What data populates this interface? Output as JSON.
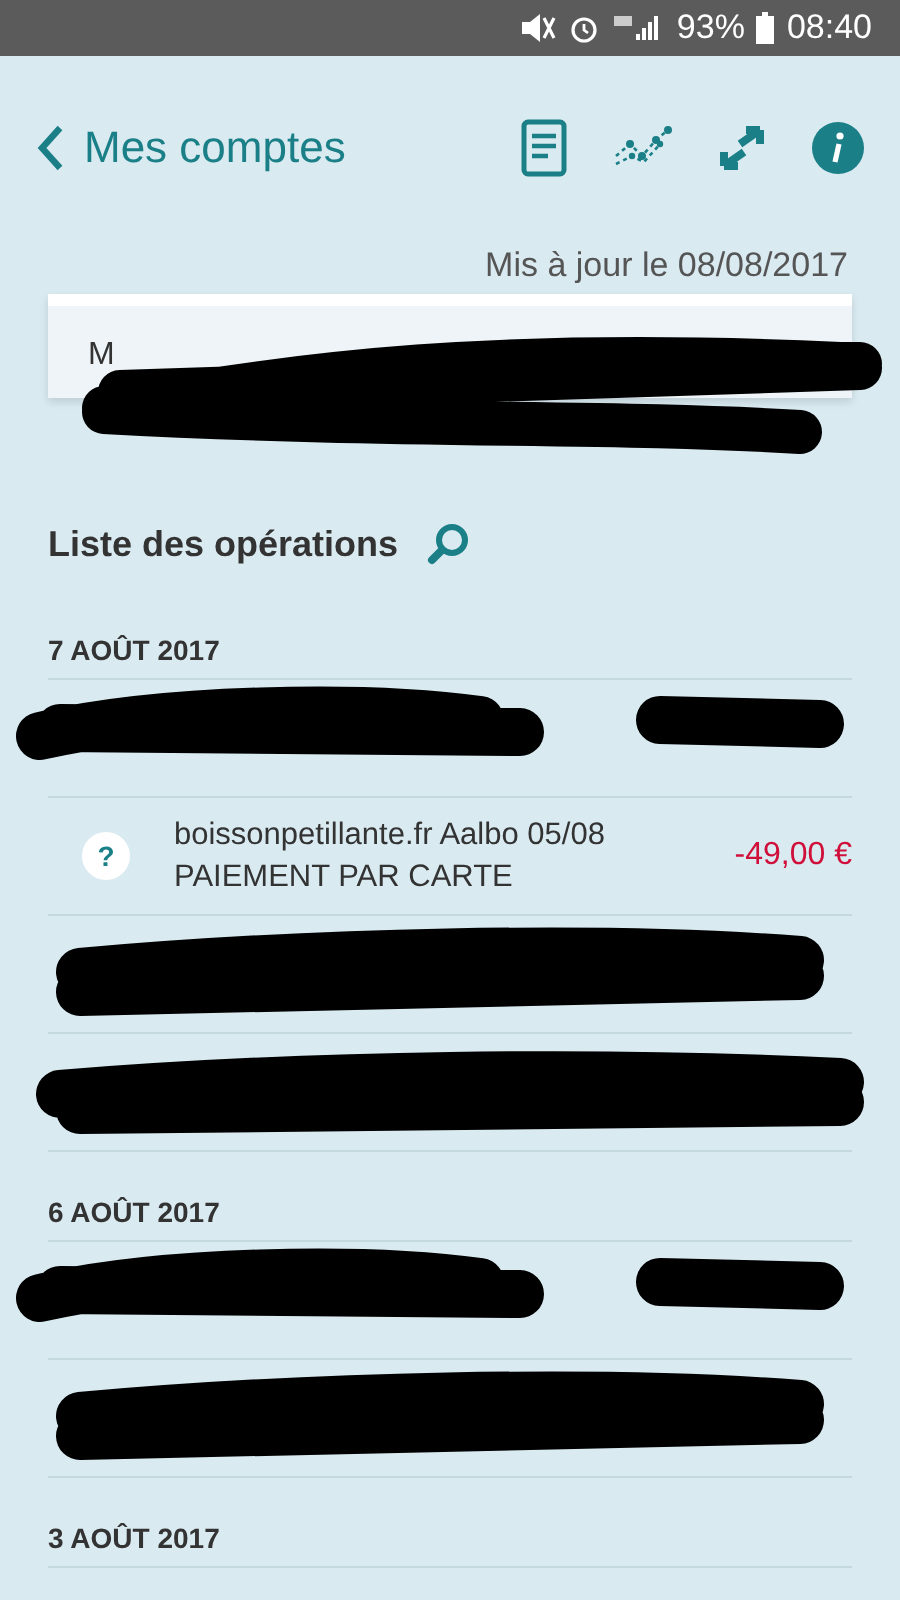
{
  "status_bar": {
    "battery": "93%",
    "time": "08:40"
  },
  "header": {
    "back_label": "Mes comptes"
  },
  "updated": "Mis à jour le 08/08/2017",
  "account_card": {
    "name": "M",
    "redacted": true
  },
  "operations": {
    "title": "Liste des opérations",
    "days": [
      {
        "date": "7 AOÛT 2017",
        "rows": [
          {
            "kind": "redacted"
          },
          {
            "kind": "operation",
            "icon": "?",
            "label": "boissonpetillante.fr Aalbo 05/08",
            "sublabel": "PAIEMENT PAR CARTE",
            "amount": "-49,00 €"
          },
          {
            "kind": "redacted"
          },
          {
            "kind": "redacted"
          }
        ]
      },
      {
        "date": "6 AOÛT 2017",
        "rows": [
          {
            "kind": "redacted"
          },
          {
            "kind": "redacted"
          }
        ]
      },
      {
        "date": "3 AOÛT 2017"
      }
    ]
  }
}
